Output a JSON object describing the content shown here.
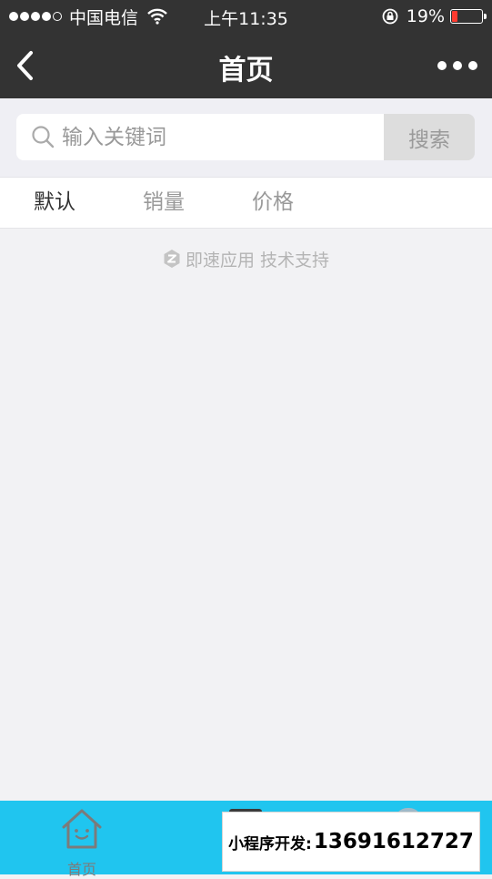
{
  "status_bar": {
    "carrier": "中国电信",
    "time": "上午11:35",
    "battery_percent": "19%",
    "battery_level": 0.19,
    "battery_color": "#ff3b30"
  },
  "nav": {
    "title": "首页",
    "back_icon": "chevron-left-icon",
    "more_icon": "more-dots-icon"
  },
  "search": {
    "placeholder": "输入关键词",
    "value": "",
    "button_label": "搜索"
  },
  "tabs": [
    {
      "label": "默认",
      "active": true
    },
    {
      "label": "销量",
      "active": false
    },
    {
      "label": "价格",
      "active": false
    }
  ],
  "support_text": "即速应用 技术支持",
  "tabbar": {
    "background": "#20c5ef",
    "items": [
      {
        "label": "首页",
        "icon": "home-icon"
      }
    ]
  },
  "promo": {
    "label": "小程序开发:",
    "phone": "13691612727"
  }
}
